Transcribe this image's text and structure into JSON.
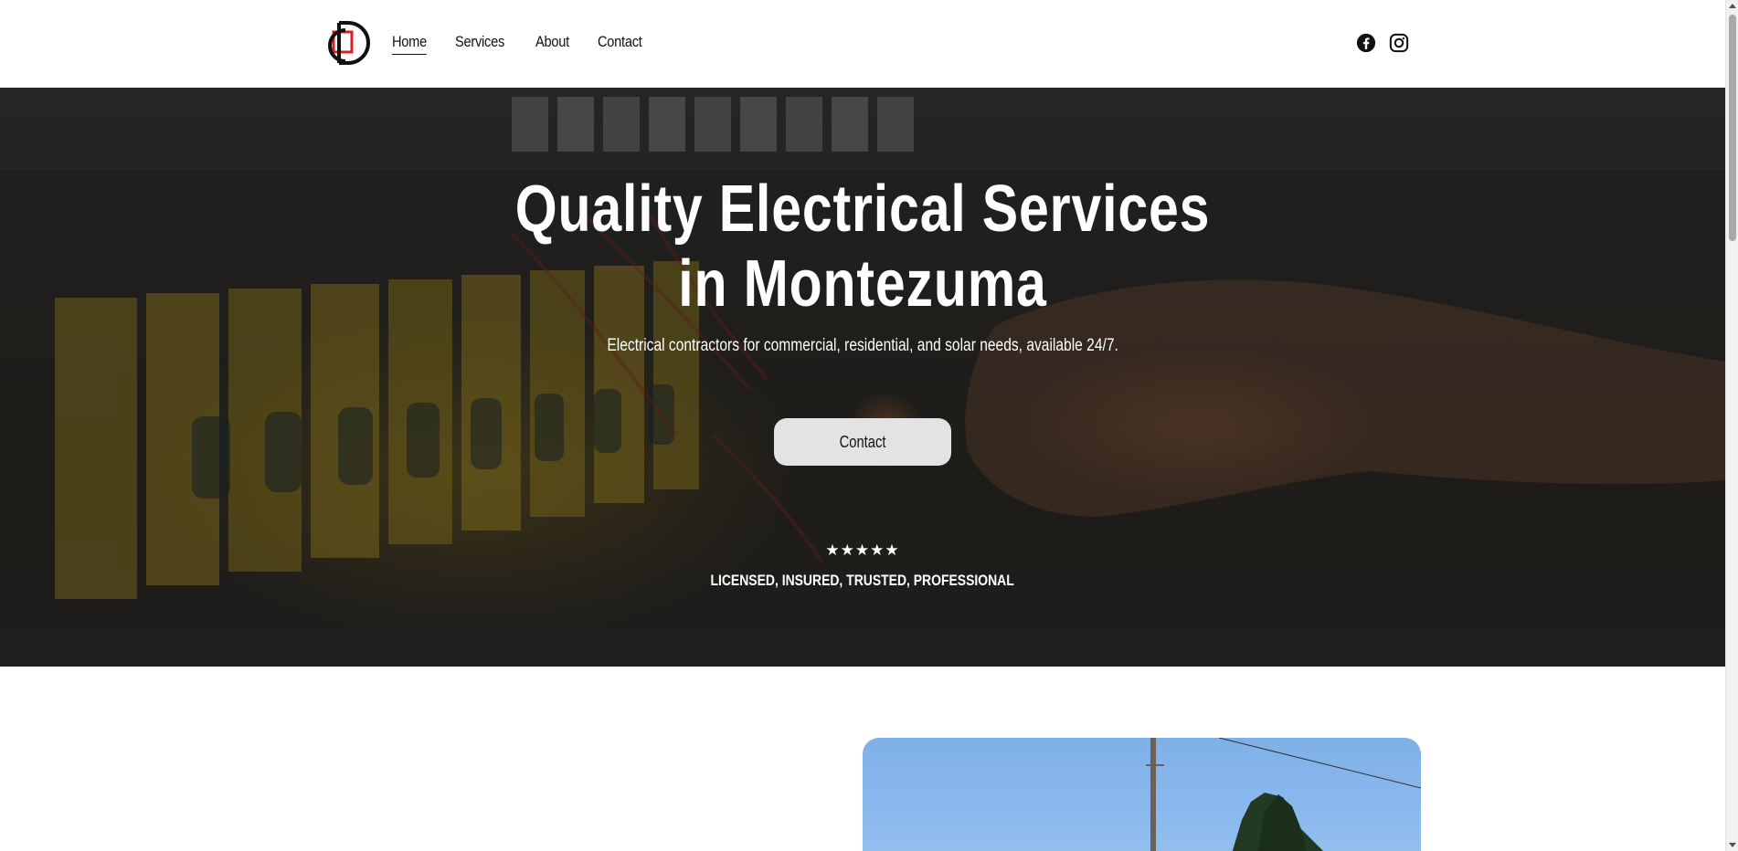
{
  "header": {
    "logo_alt": "logo",
    "nav": [
      {
        "label": "Home",
        "active": true
      },
      {
        "label": "Services",
        "active": false
      },
      {
        "label": "About",
        "active": false
      },
      {
        "label": "Contact",
        "active": false
      }
    ],
    "social": [
      {
        "icon": "facebook-icon"
      },
      {
        "icon": "instagram-icon"
      }
    ]
  },
  "hero": {
    "title_line1": "Quality Electrical Services",
    "title_line2": "in Montezuma",
    "subtitle": "Electrical contractors for commercial, residential, and solar needs, available 24/7.",
    "cta_label": "Contact",
    "rating_stars": "★★★★★",
    "rating_value": 5,
    "badge": "LICENSED, INSURED, TRUSTED, PROFESSIONAL"
  },
  "colors": {
    "accent_red": "#d81f26",
    "logo_black": "#111111",
    "button_bg": "#e3e3e3",
    "sky_blue": "#8ab9ee"
  }
}
